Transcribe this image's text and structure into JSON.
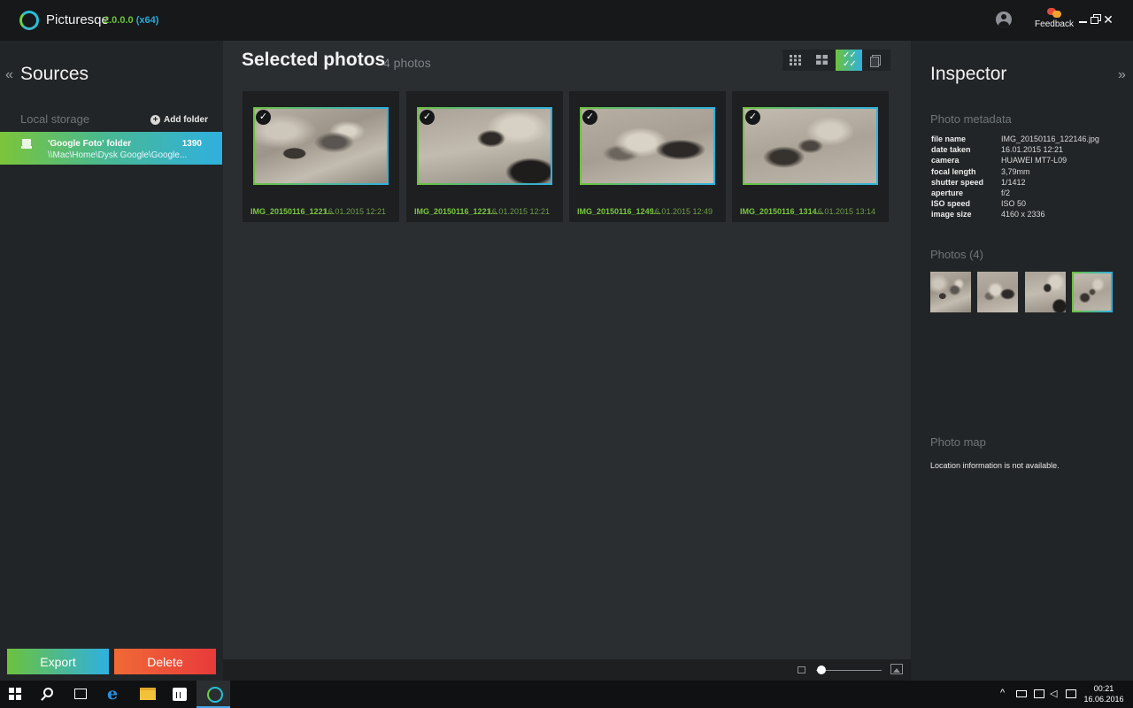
{
  "app": {
    "name": "Picturesqe",
    "version": "2.0.0.0",
    "arch": "(x64)",
    "feedback_label": "Feedback",
    "close_glyph": "✕"
  },
  "sources": {
    "title": "Sources",
    "collapse_glyph": "«",
    "local_storage_label": "Local storage",
    "add_folder_label": "Add folder",
    "items": [
      {
        "name": "'Google Foto' folder",
        "count": "1390",
        "path": "\\\\Mac\\Home\\Dysk Google\\Google..."
      }
    ]
  },
  "actions": {
    "export_label": "Export",
    "delete_label": "Delete"
  },
  "main": {
    "title": "Selected photos",
    "count_label": "4 photos",
    "view_modes": [
      "small-grid",
      "large-grid",
      "selected",
      "stack"
    ],
    "active_view": "selected",
    "photos": [
      {
        "name": "IMG_20150116_1221...",
        "date": "16.01.2015 12:21",
        "selected": true
      },
      {
        "name": "IMG_20150116_1221...",
        "date": "16.01.2015 12:21",
        "selected": true
      },
      {
        "name": "IMG_20150116_1249...",
        "date": "16.01.2015 12:49",
        "selected": true
      },
      {
        "name": "IMG_20150116_1314...",
        "date": "16.01.2015 13:14",
        "selected": true
      }
    ]
  },
  "inspector": {
    "title": "Inspector",
    "collapse_glyph": "»",
    "metadata_title": "Photo metadata",
    "metadata": [
      {
        "key": "file name",
        "value": "IMG_20150116_122146.jpg"
      },
      {
        "key": "date taken",
        "value": "16.01.2015 12:21"
      },
      {
        "key": "camera",
        "value": "HUAWEI MT7-L09"
      },
      {
        "key": "focal length",
        "value": "3,79mm"
      },
      {
        "key": "shutter speed",
        "value": "1/1412"
      },
      {
        "key": "aperture",
        "value": "f/2"
      },
      {
        "key": "ISO speed",
        "value": "ISO 50"
      },
      {
        "key": "image size",
        "value": "4160 x 2336"
      }
    ],
    "photos_title": "Photos (4)",
    "map_title": "Photo map",
    "map_message": "Location information is not available."
  },
  "taskbar": {
    "time": "00:21",
    "date": "16.06.2016"
  },
  "colors": {
    "accent_green": "#6cc23c",
    "accent_blue": "#2fb0e0",
    "delete_red": "#e83a3a"
  }
}
